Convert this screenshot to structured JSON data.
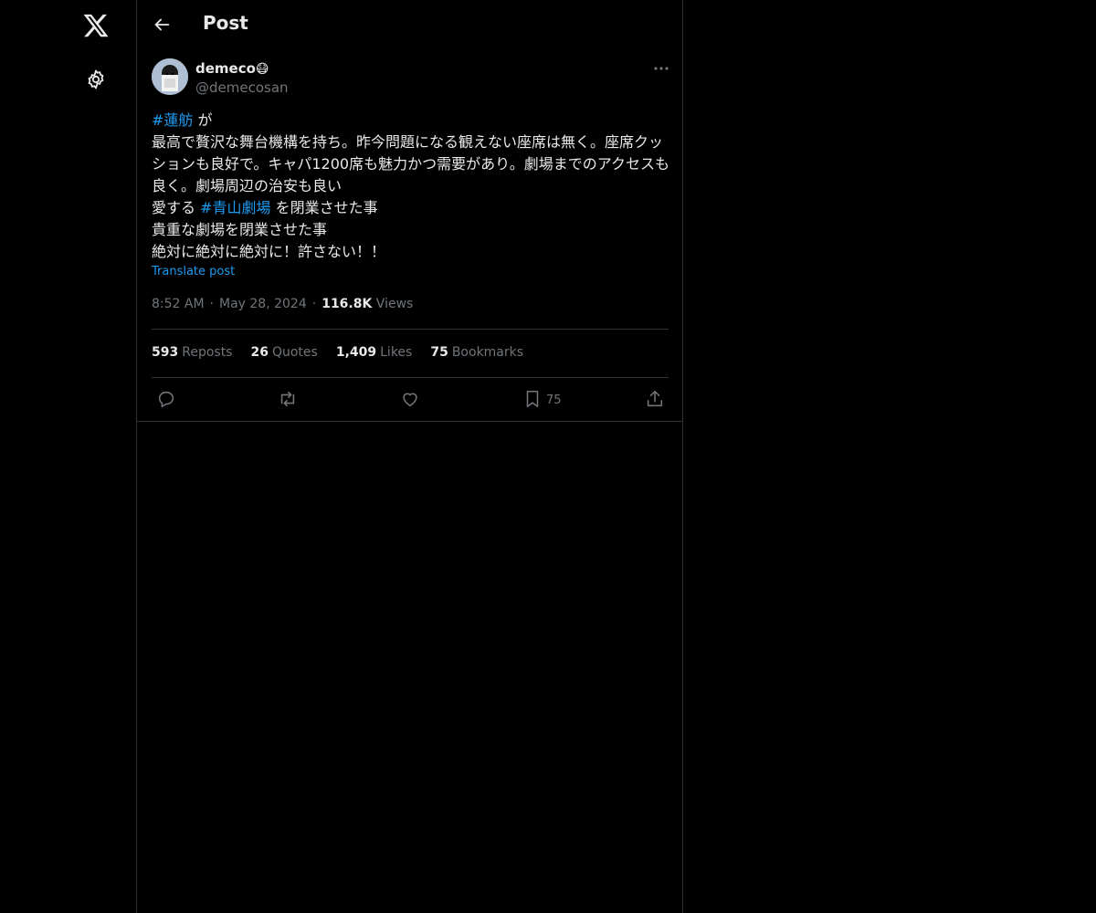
{
  "header": {
    "title": "Post"
  },
  "author": {
    "display_name": "demeco",
    "emoji": "😷",
    "handle": "@demecosan"
  },
  "post": {
    "lines": [
      {
        "parts": [
          {
            "text": "#蓮舫",
            "type": "hashtag"
          },
          {
            "text": " が",
            "type": "text"
          }
        ]
      },
      {
        "parts": [
          {
            "text": "最高で贅沢な舞台機構を持ち。昨今問題になる観えない座席は無く。座席クッションも良好で。キャパ1200席も魅力かつ需要があり。劇場までのアクセスも良く。劇場周辺の治安も良い",
            "type": "text"
          }
        ]
      },
      {
        "parts": [
          {
            "text": "愛する ",
            "type": "text"
          },
          {
            "text": "#青山劇場",
            "type": "hashtag"
          },
          {
            "text": " を閉業させた事",
            "type": "text"
          }
        ]
      },
      {
        "parts": [
          {
            "text": "貴重な劇場を閉業させた事",
            "type": "text"
          }
        ]
      },
      {
        "parts": [
          {
            "text": "絶対に絶対に絶対に！許さない！！",
            "type": "text"
          }
        ]
      }
    ],
    "translate_label": "Translate post",
    "time": "8:52 AM",
    "date": "May 28, 2024",
    "views_count": "116.8K",
    "views_label": "Views"
  },
  "stats": {
    "reposts_count": "593",
    "reposts_label": "Reposts",
    "quotes_count": "26",
    "quotes_label": "Quotes",
    "likes_count": "1,409",
    "likes_label": "Likes",
    "bookmarks_count": "75",
    "bookmarks_label": "Bookmarks"
  },
  "actions": {
    "bookmark_count": "75"
  },
  "icons": {
    "logo": "x-logo-icon",
    "settings": "gear-icon",
    "back": "back-arrow-icon",
    "more": "more-icon",
    "reply": "reply-icon",
    "repost": "repost-icon",
    "like": "heart-icon",
    "bookmark": "bookmark-icon",
    "share": "share-icon"
  },
  "colors": {
    "background": "#000000",
    "text": "#e7e9ea",
    "muted": "#71767b",
    "accent": "#1d9bf0",
    "border": "#2f3336"
  }
}
